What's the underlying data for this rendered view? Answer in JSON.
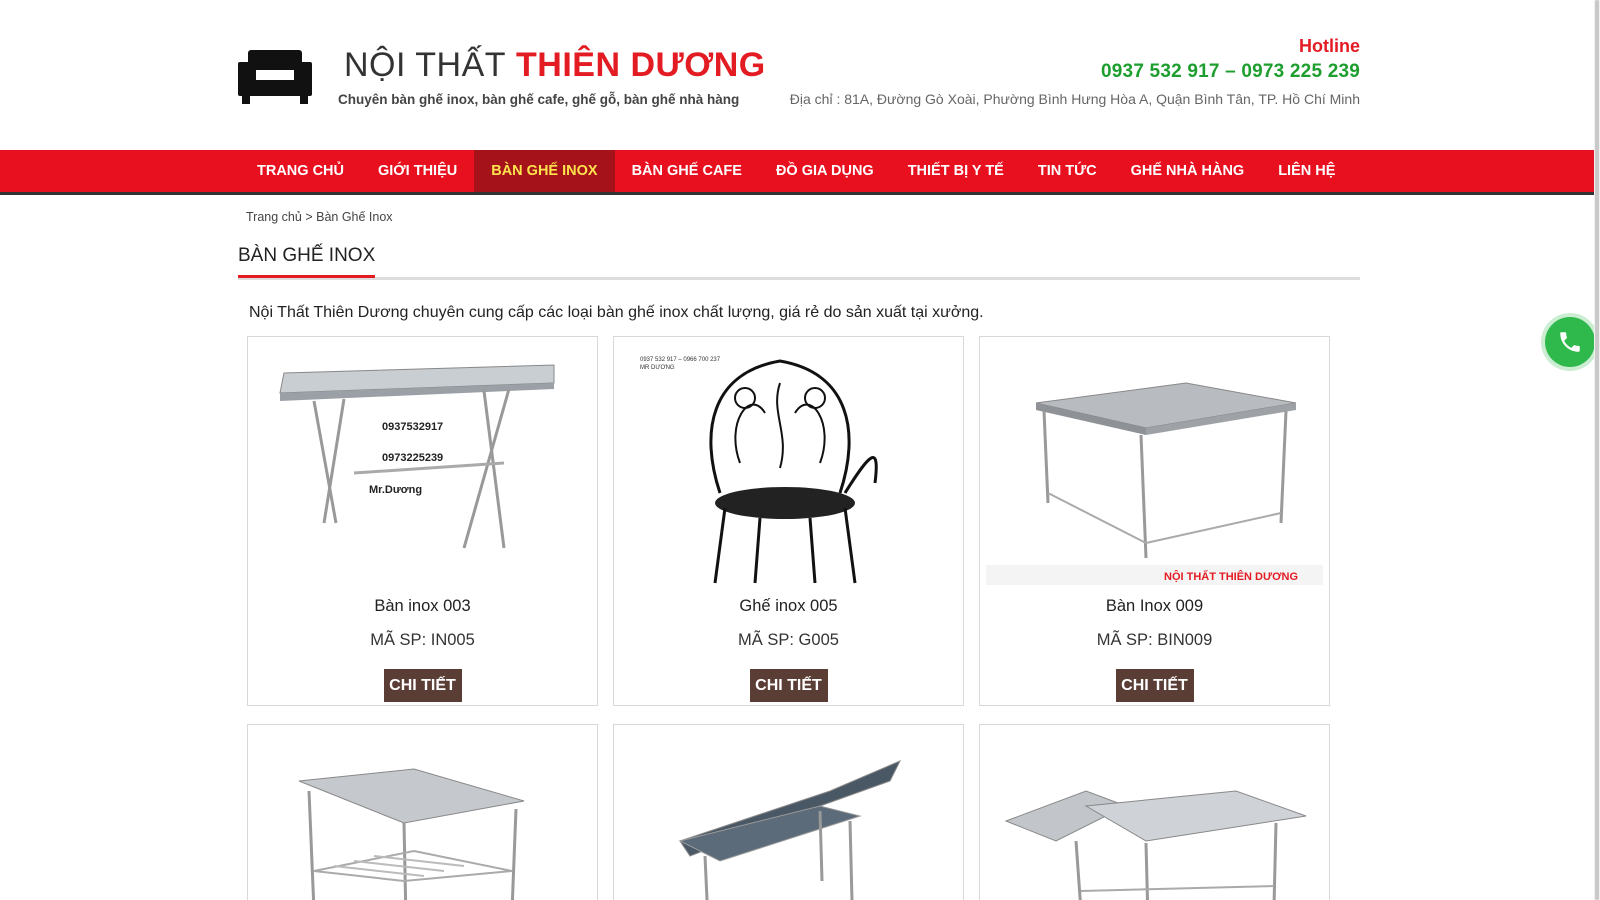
{
  "brand": {
    "name_light": "NỘI THẤT",
    "name_bold": "THIÊN DƯƠNG",
    "tagline": "Chuyên bàn ghế inox, bàn ghế cafe, ghế gỗ, bàn ghế nhà hàng"
  },
  "contact": {
    "hotline_label": "Hotline",
    "hotline_numbers": "0937 532 917 – 0973 225 239",
    "address": "Địa chỉ : 81A, Đường Gò Xoài, Phường Bình Hưng Hòa A, Quận Bình Tân, TP. Hồ Chí Minh"
  },
  "nav": {
    "items": [
      {
        "label": "TRANG CHỦ"
      },
      {
        "label": "GIỚI THIỆU"
      },
      {
        "label": "BÀN GHẾ INOX",
        "active": true
      },
      {
        "label": "BÀN GHẾ CAFE"
      },
      {
        "label": "ĐỒ GIA DỤNG"
      },
      {
        "label": "THIẾT BỊ Y TẾ"
      },
      {
        "label": "TIN TỨC"
      },
      {
        "label": "GHẾ NHÀ HÀNG"
      },
      {
        "label": "LIÊN HỆ"
      }
    ]
  },
  "breadcrumb": {
    "home": "Trang chủ",
    "separator": ">",
    "current": "Bàn Ghế Inox"
  },
  "page": {
    "title": "BÀN GHẾ INOX",
    "intro": "Nội Thất Thiên Dương chuyên cung cấp các loại bàn ghế inox chất lượng, giá rẻ do sản xuất tại xưởng."
  },
  "products": [
    {
      "name": "Bàn inox 003",
      "code": "MÃ SP: IN005",
      "button": "CHI TIẾT",
      "image_icon": "folding-table-image",
      "overlay": [
        "0937532917",
        "0973225239",
        "Mr.Dương"
      ]
    },
    {
      "name": "Ghế inox 005",
      "code": "MÃ SP: G005",
      "button": "CHI TIẾT",
      "image_icon": "iron-chair-image",
      "overlay": [
        "0937 532 917 – 0966 700 237",
        "MR DƯƠNG"
      ]
    },
    {
      "name": "Bàn Inox 009",
      "code": "MÃ SP: BIN009",
      "button": "CHI TIẾT",
      "image_icon": "steel-table-image",
      "overlay": [
        "NỘI THẤT THIÊN DƯƠNG"
      ]
    },
    {
      "name": "",
      "code": "",
      "button": "",
      "image_icon": "shelf-table-image",
      "overlay": []
    },
    {
      "name": "",
      "code": "",
      "button": "",
      "image_icon": "exam-bed-image",
      "overlay": []
    },
    {
      "name": "",
      "code": "",
      "button": "",
      "image_icon": "stretcher-bed-image",
      "overlay": []
    }
  ],
  "colors": {
    "brand_red": "#e31b23",
    "nav_red": "#e8101f",
    "nav_active_bg": "#a5121a",
    "nav_active_text": "#ffe34d",
    "hotline_green": "#1e9e2f",
    "button_brown": "#5a3e36",
    "call_green": "#2fb84b"
  },
  "floating": {
    "icon": "phone-icon"
  }
}
